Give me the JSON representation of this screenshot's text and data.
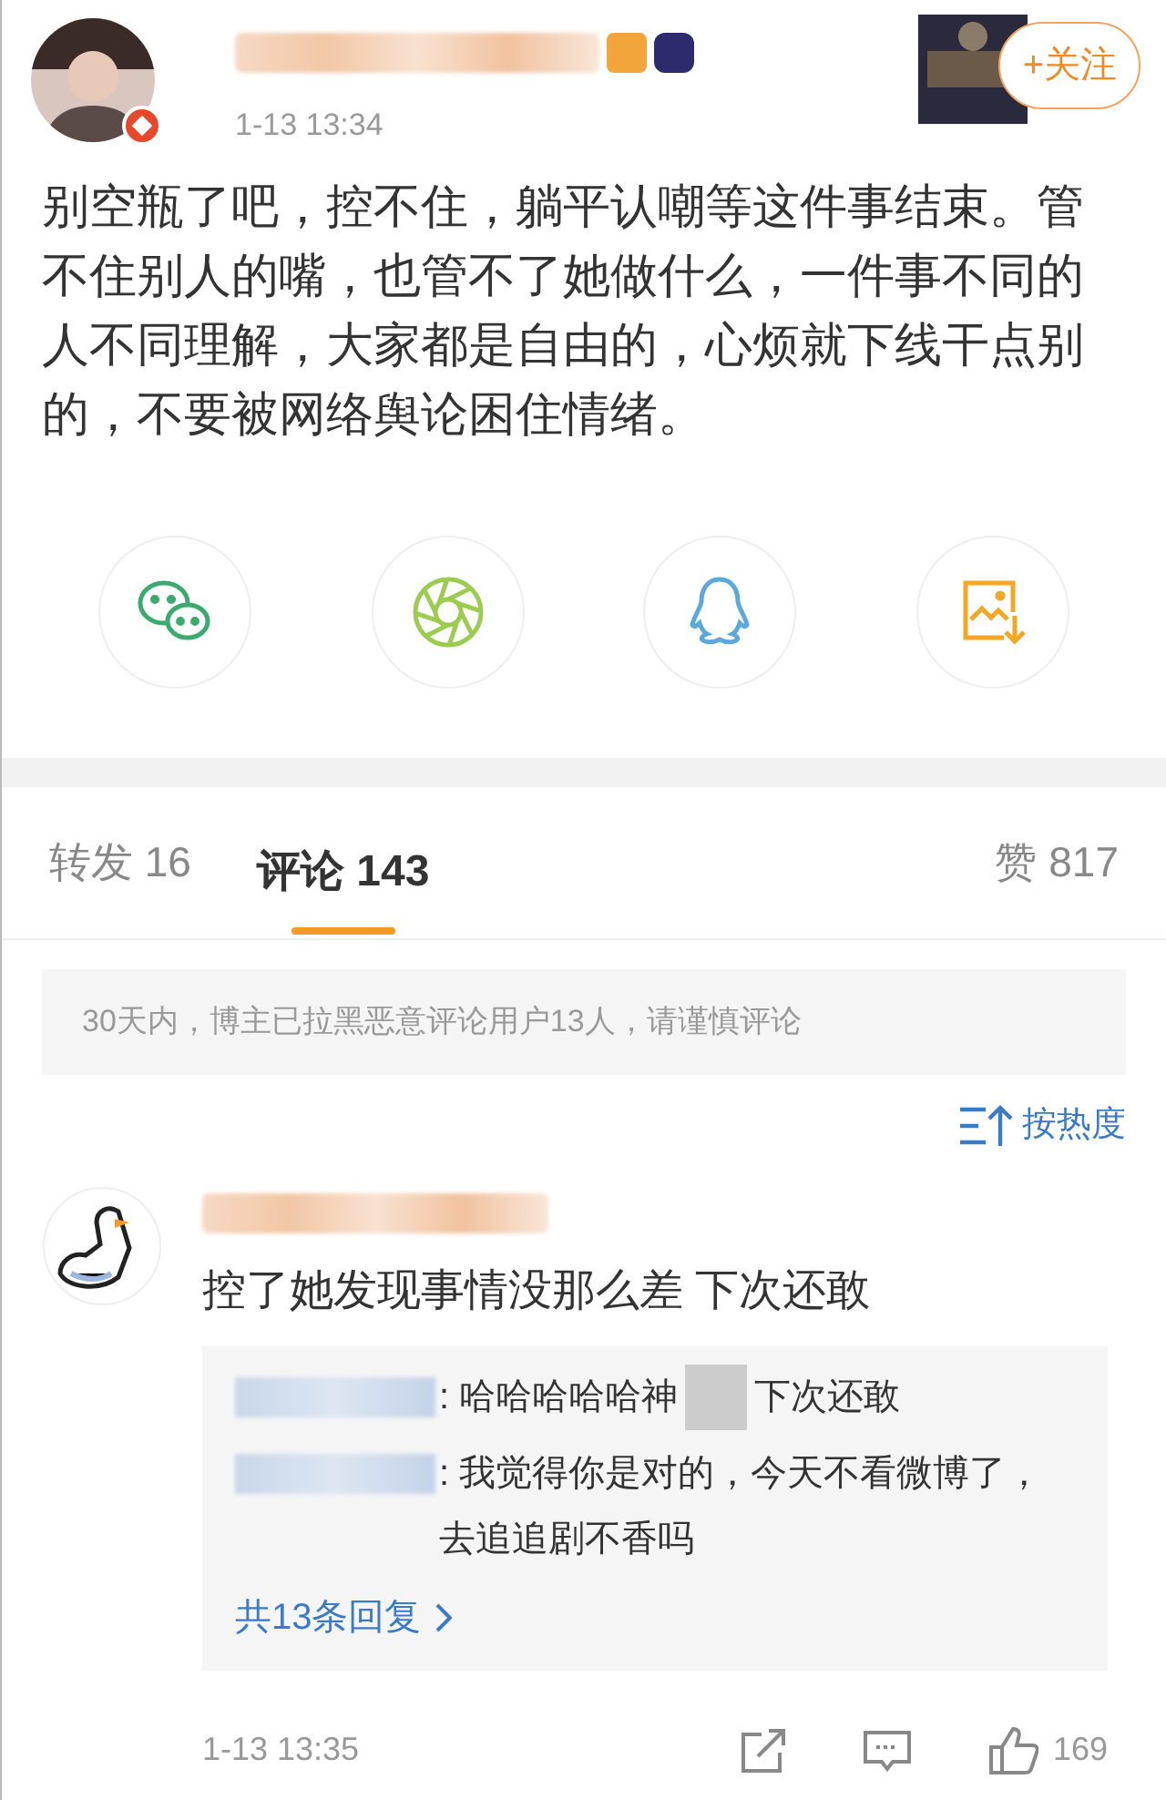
{
  "post": {
    "time": "1-13 13:34",
    "follow_button": "+关注",
    "text": "别空瓶了吧，控不住，躺平认嘲等这件事结束。管不住别人的嘴，也管不了她做什么，一件事不同的人不同理解，大家都是自由的，心烦就下线干点别的，不要被网络舆论困住情绪。"
  },
  "share": [
    {
      "kind": "wechat"
    },
    {
      "kind": "moments"
    },
    {
      "kind": "qq"
    },
    {
      "kind": "save"
    }
  ],
  "tabs": [
    {
      "label": "转发 16",
      "selected": false
    },
    {
      "label": "评论 143",
      "selected": true
    },
    {
      "label": "赞 817",
      "selected": false
    }
  ],
  "notice": "30天内，博主已拉黑恶意评论用户13人，请谨慎评论",
  "sort": "按热度",
  "comment": {
    "text": "控了她发现事情没那么差 下次还敢",
    "replies": [
      {
        "text": ": 哈哈哈哈哈神",
        "text_after": "下次还敢"
      },
      {
        "text": ": 我觉得你是对的，今天不看微博了，去追追剧不香吗"
      }
    ],
    "more": "共13条回复",
    "time": "1-13 13:35",
    "likes": "169"
  }
}
